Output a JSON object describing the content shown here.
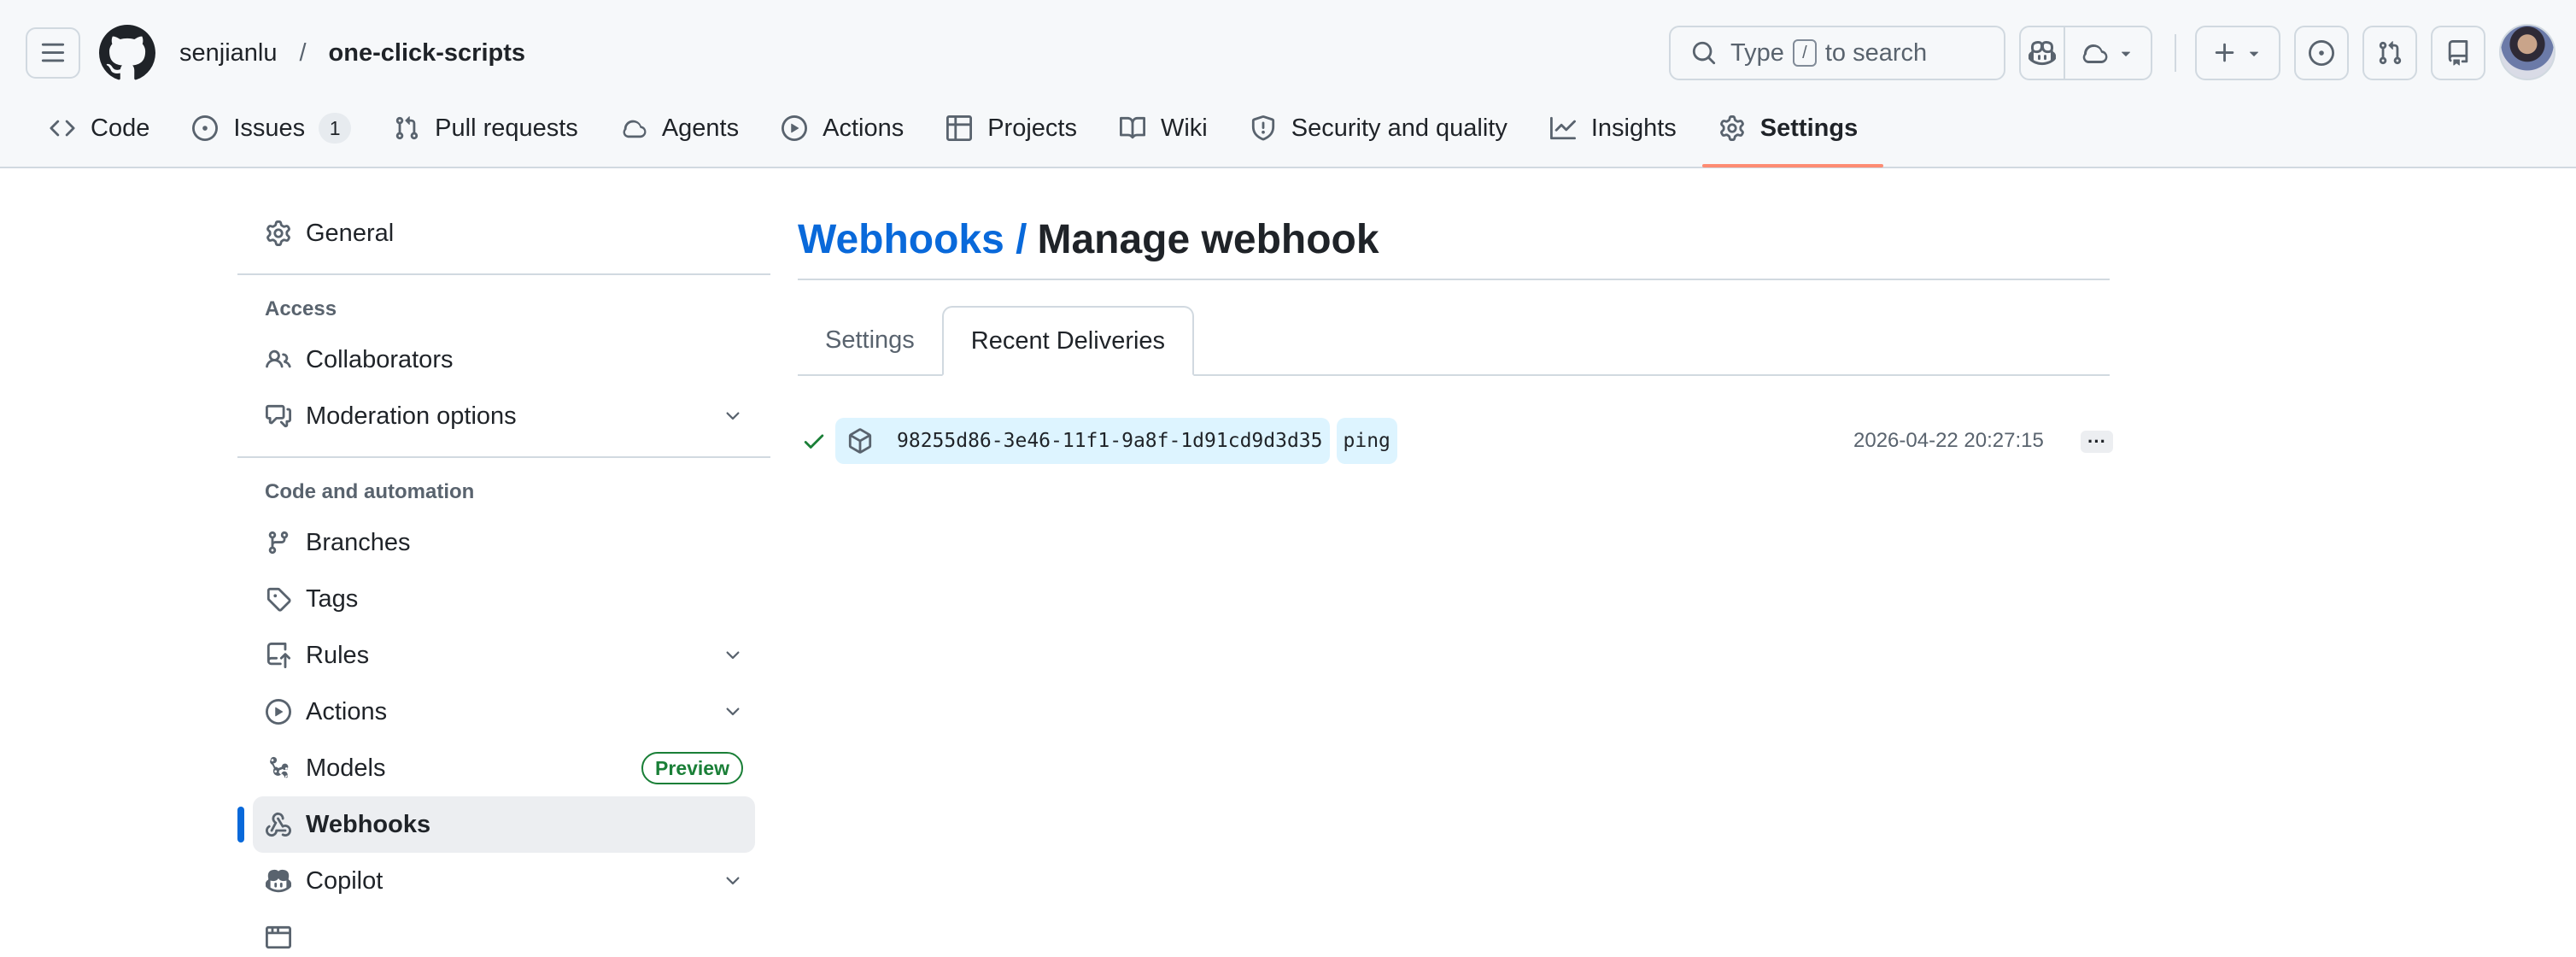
{
  "header": {
    "owner": "senjianlu",
    "separator": "/",
    "repo": "one-click-scripts",
    "search": {
      "prefix": "Type",
      "key": "/",
      "suffix": "to search"
    }
  },
  "repo_tabs": [
    {
      "label": "Code",
      "icon": "code-icon"
    },
    {
      "label": "Issues",
      "icon": "issue-opened-icon",
      "count": "1"
    },
    {
      "label": "Pull requests",
      "icon": "git-pull-request-icon"
    },
    {
      "label": "Agents",
      "icon": "agent-icon"
    },
    {
      "label": "Actions",
      "icon": "play-icon"
    },
    {
      "label": "Projects",
      "icon": "table-icon"
    },
    {
      "label": "Wiki",
      "icon": "book-icon"
    },
    {
      "label": "Security and quality",
      "icon": "shield-icon"
    },
    {
      "label": "Insights",
      "icon": "graph-icon"
    },
    {
      "label": "Settings",
      "icon": "gear-icon",
      "selected": true
    }
  ],
  "sidebar": {
    "general": "General",
    "access_heading": "Access",
    "collaborators": "Collaborators",
    "moderation": "Moderation options",
    "code_heading": "Code and automation",
    "branches": "Branches",
    "tags": "Tags",
    "rules": "Rules",
    "actions": "Actions",
    "models": "Models",
    "models_badge": "Preview",
    "webhooks": "Webhooks",
    "copilot": "Copilot"
  },
  "main": {
    "crumb": "Webhooks /",
    "title": "Manage webhook",
    "tabs": {
      "settings": "Settings",
      "recent": "Recent Deliveries"
    },
    "deliveries": [
      {
        "guid": "98255d86-3e46-11f1-9a8f-1d91cd9d3d35",
        "event": "ping",
        "timestamp": "2026-04-22 20:27:15",
        "more": "···"
      }
    ]
  },
  "colors": {
    "accent": "#0969da",
    "success": "#1a7f37",
    "selected_underline": "#fd8c73",
    "chip_bg": "#ddf4ff"
  }
}
